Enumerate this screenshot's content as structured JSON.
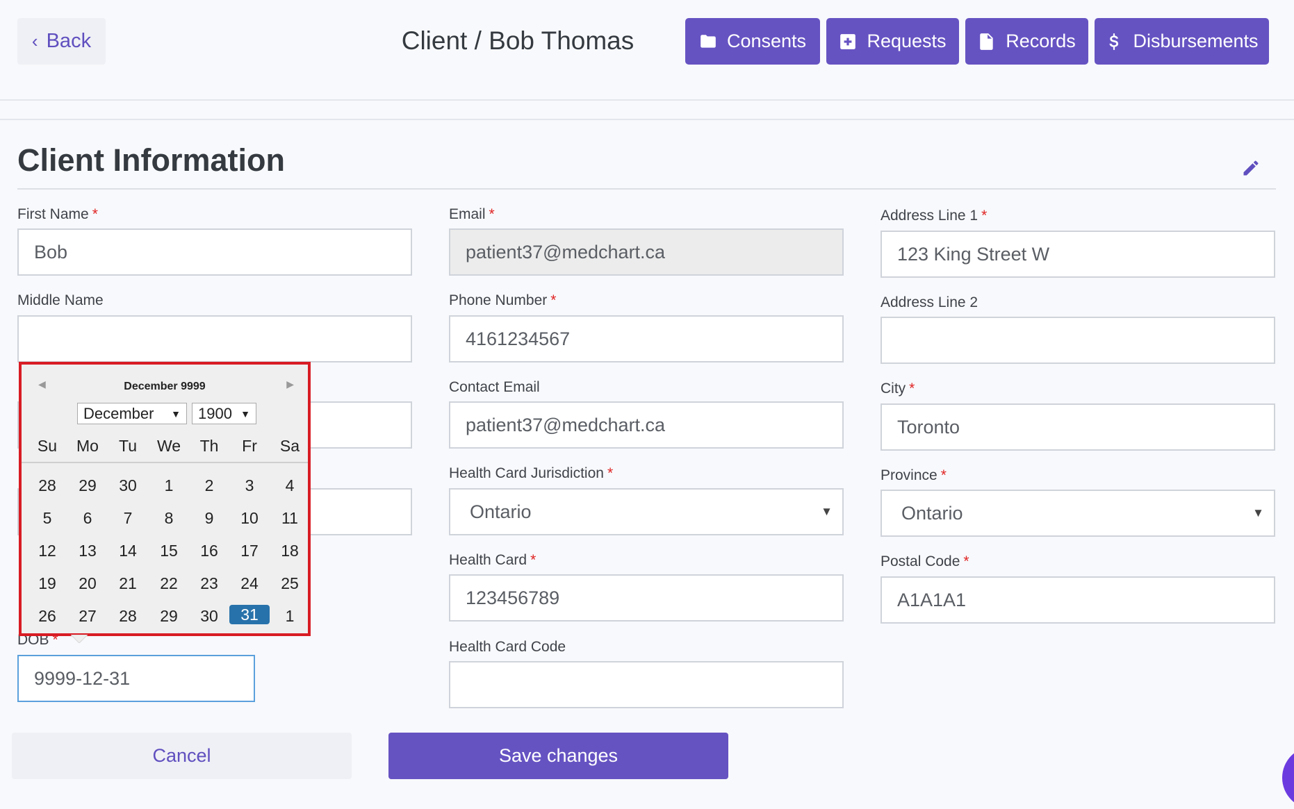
{
  "header": {
    "back_label": "Back",
    "title": "Client / Bob Thomas",
    "nav": [
      {
        "label": "Consents",
        "icon": "folder-icon"
      },
      {
        "label": "Requests",
        "icon": "plus-square-icon"
      },
      {
        "label": "Records",
        "icon": "file-icon"
      },
      {
        "label": "Disbursements",
        "icon": "dollar-icon"
      }
    ]
  },
  "section": {
    "title": "Client Information",
    "edit_icon": "pencil-icon"
  },
  "form": {
    "first_name": {
      "label": "First Name",
      "value": "Bob"
    },
    "middle_name": {
      "label": "Middle Name",
      "value": ""
    },
    "dob": {
      "label": "DOB",
      "value": "9999-12-31"
    },
    "email": {
      "label": "Email",
      "value": "patient37@medchart.ca"
    },
    "phone": {
      "label": "Phone Number",
      "value": "4161234567"
    },
    "contact_email": {
      "label": "Contact Email",
      "value": "patient37@medchart.ca"
    },
    "hc_jurisdiction": {
      "label": "Health Card Jurisdiction",
      "value": "Ontario"
    },
    "health_card": {
      "label": "Health Card",
      "value": "123456789"
    },
    "health_card_code": {
      "label": "Health Card Code",
      "value": ""
    },
    "address1": {
      "label": "Address Line 1",
      "value": "123 King Street W"
    },
    "address2": {
      "label": "Address Line 2",
      "value": ""
    },
    "city": {
      "label": "City",
      "value": "Toronto"
    },
    "province": {
      "label": "Province",
      "value": "Ontario"
    },
    "postal_code": {
      "label": "Postal Code",
      "value": "A1A1A1"
    },
    "required_mark": "*"
  },
  "calendar": {
    "title": "December 9999",
    "month_select": "December",
    "year_select": "1900",
    "weekdays": [
      "Su",
      "Mo",
      "Tu",
      "We",
      "Th",
      "Fr",
      "Sa"
    ],
    "weeks": [
      [
        "28",
        "29",
        "30",
        "1",
        "2",
        "3",
        "4"
      ],
      [
        "5",
        "6",
        "7",
        "8",
        "9",
        "10",
        "11"
      ],
      [
        "12",
        "13",
        "14",
        "15",
        "16",
        "17",
        "18"
      ],
      [
        "19",
        "20",
        "21",
        "22",
        "23",
        "24",
        "25"
      ],
      [
        "26",
        "27",
        "28",
        "29",
        "30",
        "31",
        "1"
      ]
    ],
    "selected_day": "31",
    "highlight_color": "#2872ab"
  },
  "actions": {
    "cancel_label": "Cancel",
    "save_label": "Save changes"
  },
  "colors": {
    "primary": "#6653c2",
    "required": "#e02424",
    "outline": "#d81c24"
  }
}
